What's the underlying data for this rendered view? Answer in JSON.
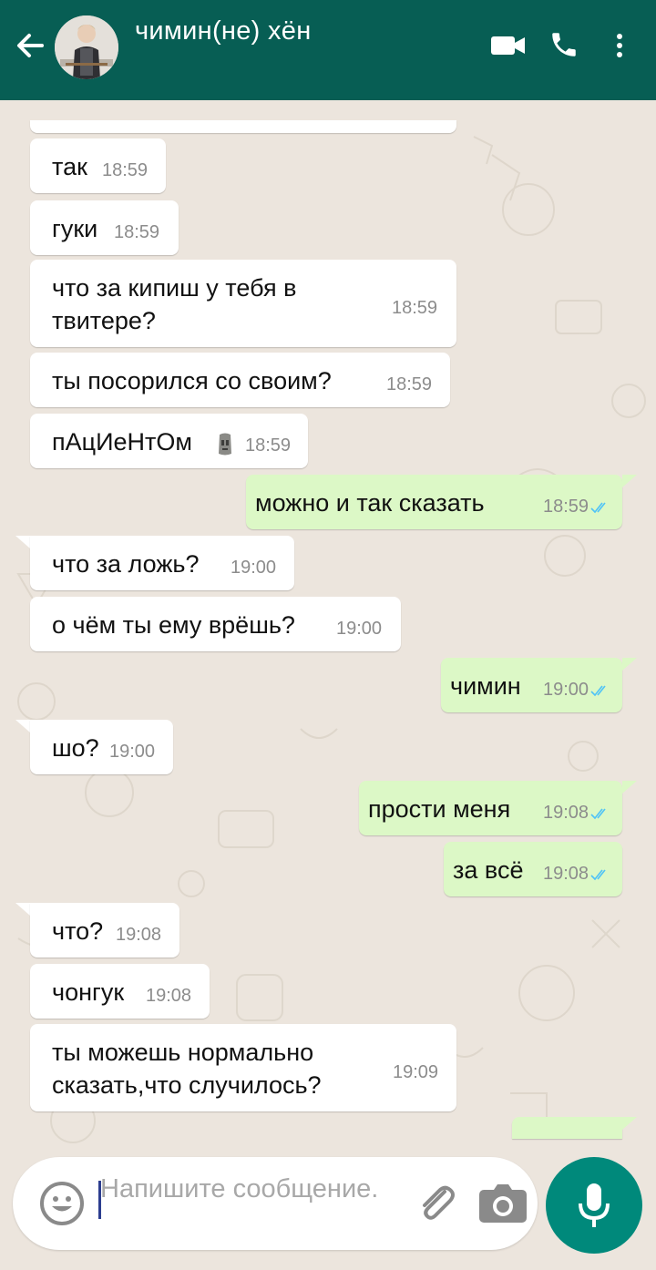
{
  "header": {
    "contact_name": "чимин(не) хён",
    "icons": {
      "back": "arrow-left-icon",
      "video": "video-call-icon",
      "call": "phone-icon",
      "menu": "more-vertical-icon"
    },
    "color": "#075e54"
  },
  "messages": [
    {
      "dir": "in",
      "text": "так",
      "time": "18:59"
    },
    {
      "dir": "in",
      "text": "гуки",
      "time": "18:59"
    },
    {
      "dir": "in",
      "text_line1": "что за кипиш у тебя в",
      "text_line2": "твитере?",
      "time": "18:59"
    },
    {
      "dir": "in",
      "text": "ты посорился со своим?",
      "time": "18:59"
    },
    {
      "dir": "in",
      "text": "пАцИеНтОм",
      "emoji": "moai-emoji-icon",
      "time": "18:59"
    },
    {
      "dir": "out",
      "text": "можно и так сказать",
      "time": "18:59",
      "status": "read"
    },
    {
      "dir": "in",
      "text": "что за ложь?",
      "time": "19:00"
    },
    {
      "dir": "in",
      "text": "о чём ты ему врёшь?",
      "time": "19:00"
    },
    {
      "dir": "out",
      "text": "чимин",
      "time": "19:00",
      "status": "read"
    },
    {
      "dir": "in",
      "text": "шо?",
      "time": "19:00"
    },
    {
      "dir": "out",
      "text": "прости меня",
      "time": "19:08",
      "status": "read"
    },
    {
      "dir": "out",
      "text": "за всё",
      "time": "19:08",
      "status": "read"
    },
    {
      "dir": "in",
      "text": "что?",
      "time": "19:08"
    },
    {
      "dir": "in",
      "text": "чонгук",
      "time": "19:08"
    },
    {
      "dir": "in",
      "text_line1": "ты можешь нормально",
      "text_line2": "сказать,что случилось?",
      "time": "19:09"
    }
  ],
  "input": {
    "placeholder": "Напишите сообщение.",
    "value": "",
    "icons": {
      "emoji": "smiley-icon",
      "attach": "paperclip-icon",
      "camera": "camera-icon",
      "mic": "microphone-icon"
    }
  },
  "colors": {
    "incoming_bubble": "#ffffff",
    "outgoing_bubble": "#dcf8c6",
    "read_ticks": "#4fc3f7",
    "mic_button": "#00897b",
    "chat_background": "#ece5dd"
  }
}
